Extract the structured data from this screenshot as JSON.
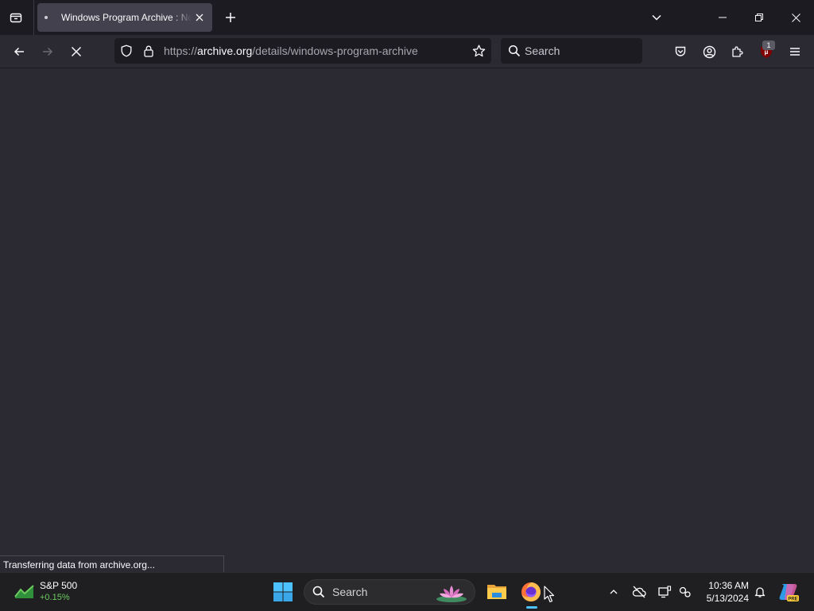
{
  "browser": {
    "tab": {
      "title": "Windows Program Archive : No"
    },
    "url": {
      "scheme": "https://",
      "host": "archive.org",
      "path": "/details/windows-program-archive"
    },
    "search_placeholder": "Search",
    "extension_badge": "1",
    "status_text": "Transferring data from archive.org...",
    "icons": [
      "tab-list-icon",
      "close-icon",
      "plus-icon",
      "chevron-down-icon",
      "minimize-icon",
      "restore-icon",
      "back-icon",
      "forward-icon",
      "stop-icon",
      "shield-icon",
      "lock-icon",
      "star-icon",
      "search-icon",
      "pocket-icon",
      "account-icon",
      "extensions-icon",
      "ublock-icon",
      "menu-icon"
    ]
  },
  "taskbar": {
    "widget": {
      "name": "S&P 500",
      "change": "+0.15%",
      "change_color": "#6ccb5f"
    },
    "search_placeholder": "Search",
    "clock": {
      "time": "10:36 AM",
      "date": "5/13/2024"
    },
    "accent_color": "#4cc2ff"
  }
}
